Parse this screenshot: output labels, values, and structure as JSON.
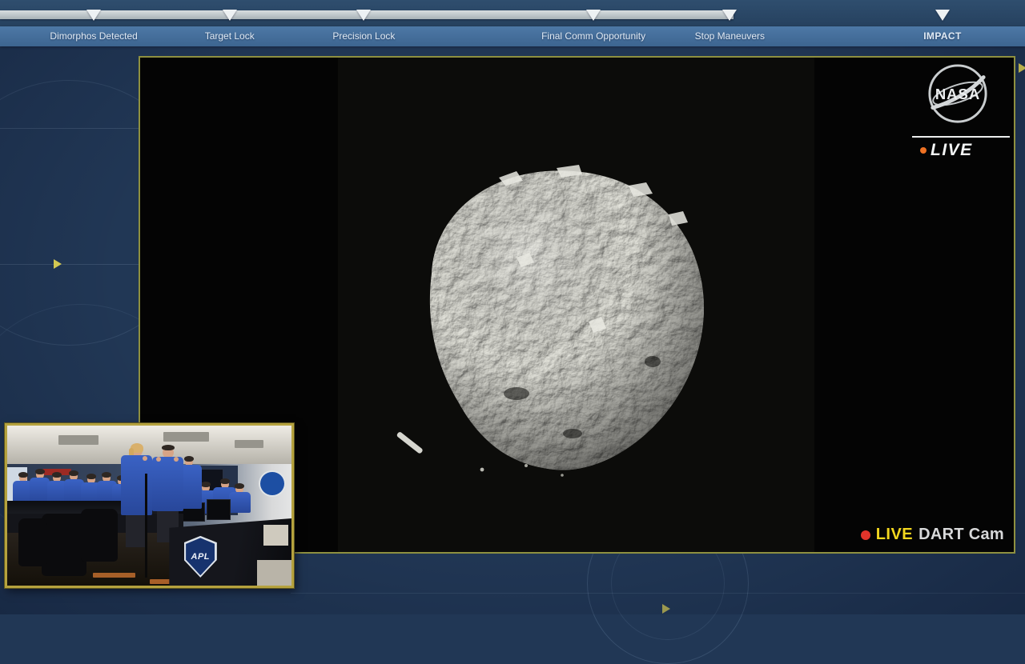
{
  "timeline": {
    "milestones": [
      {
        "label": "Dimorphos Detected",
        "x_pct": 9.15
      },
      {
        "label": "Target Lock",
        "x_pct": 22.4
      },
      {
        "label": "Precision Lock",
        "x_pct": 35.5
      },
      {
        "label": "Final Comm Opportunity",
        "x_pct": 57.9
      },
      {
        "label": "Stop Maneuvers",
        "x_pct": 71.2
      },
      {
        "label": "IMPACT",
        "x_pct": 91.95
      }
    ],
    "progress_fraction": 0.72
  },
  "overlay": {
    "brand": "NASA",
    "live_label": "LIVE"
  },
  "caption": {
    "live_label": "LIVE",
    "camera_label": "DART Cam"
  },
  "pip": {
    "apl_label": "APL"
  },
  "colors": {
    "background_navy": "#213755",
    "milestone_band_blue": "#46719c",
    "progress_bar_silver": "#b9c1c5",
    "video_frame_border": "#8e9040",
    "pip_border_gold": "#b5a23e",
    "live_yellow": "#f3d71f",
    "record_red": "#e0342b",
    "live_dot_orange": "#ee7123",
    "asteroid_grey": "#8f8f88"
  }
}
